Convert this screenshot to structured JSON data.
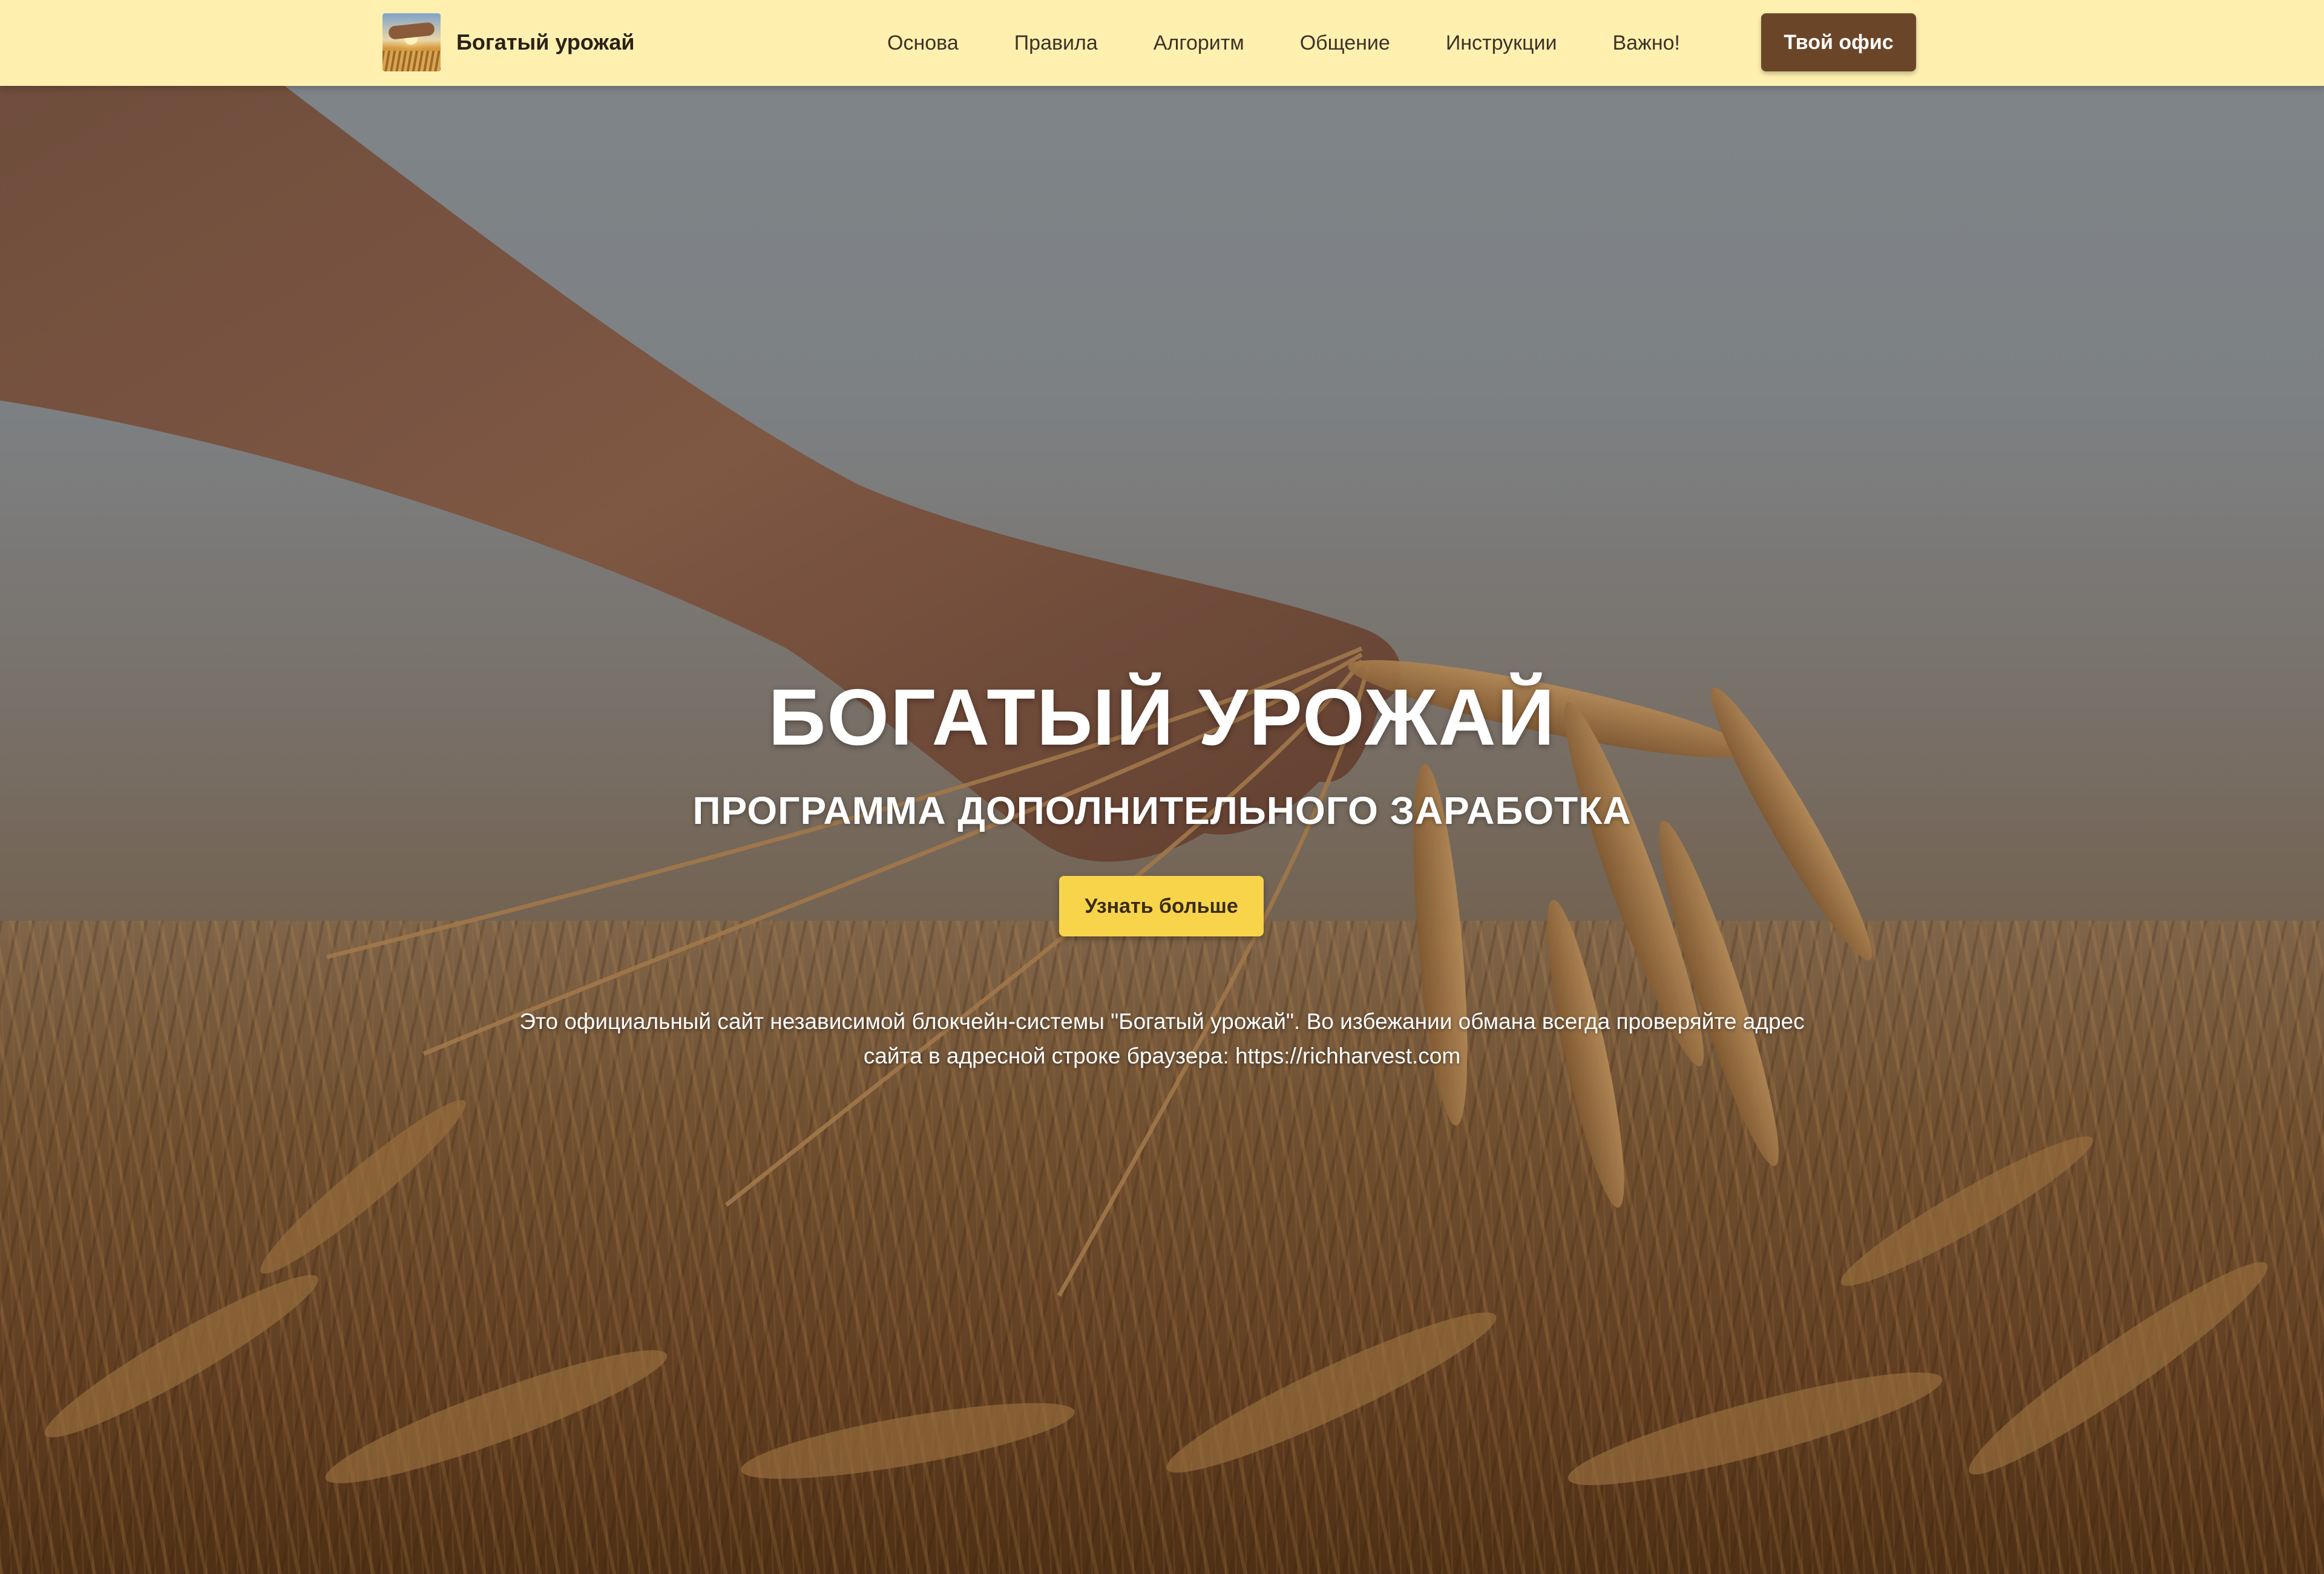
{
  "header": {
    "brand_name": "Богатый урожай",
    "nav": [
      {
        "label": "Основа"
      },
      {
        "label": "Правила"
      },
      {
        "label": "Алгоритм"
      },
      {
        "label": "Общение"
      },
      {
        "label": "Инструкции"
      },
      {
        "label": "Важно!"
      }
    ],
    "office_button_label": "Твой офис"
  },
  "hero": {
    "title": "БОГАТЫЙ УРОЖАЙ",
    "subtitle": "ПРОГРАММА ДОПОЛНИТЕЛЬНОГО ЗАРАБОТКА",
    "cta_label": "Узнать больше",
    "notice": "Это официальный сайт независимой блокчейн-системы \"Богатый урожай\". Во избежании обмана всегда проверяйте адрес сайта в адресной строке браузера: https://richharvest.com"
  },
  "colors": {
    "navbar_bg": "#fff0b0",
    "office_button_bg": "#6b4527",
    "cta_button_bg": "#f8d44a",
    "hero_text": "#ffffff"
  },
  "icons": {
    "brand_logo": "wheat-handshake-logo"
  }
}
